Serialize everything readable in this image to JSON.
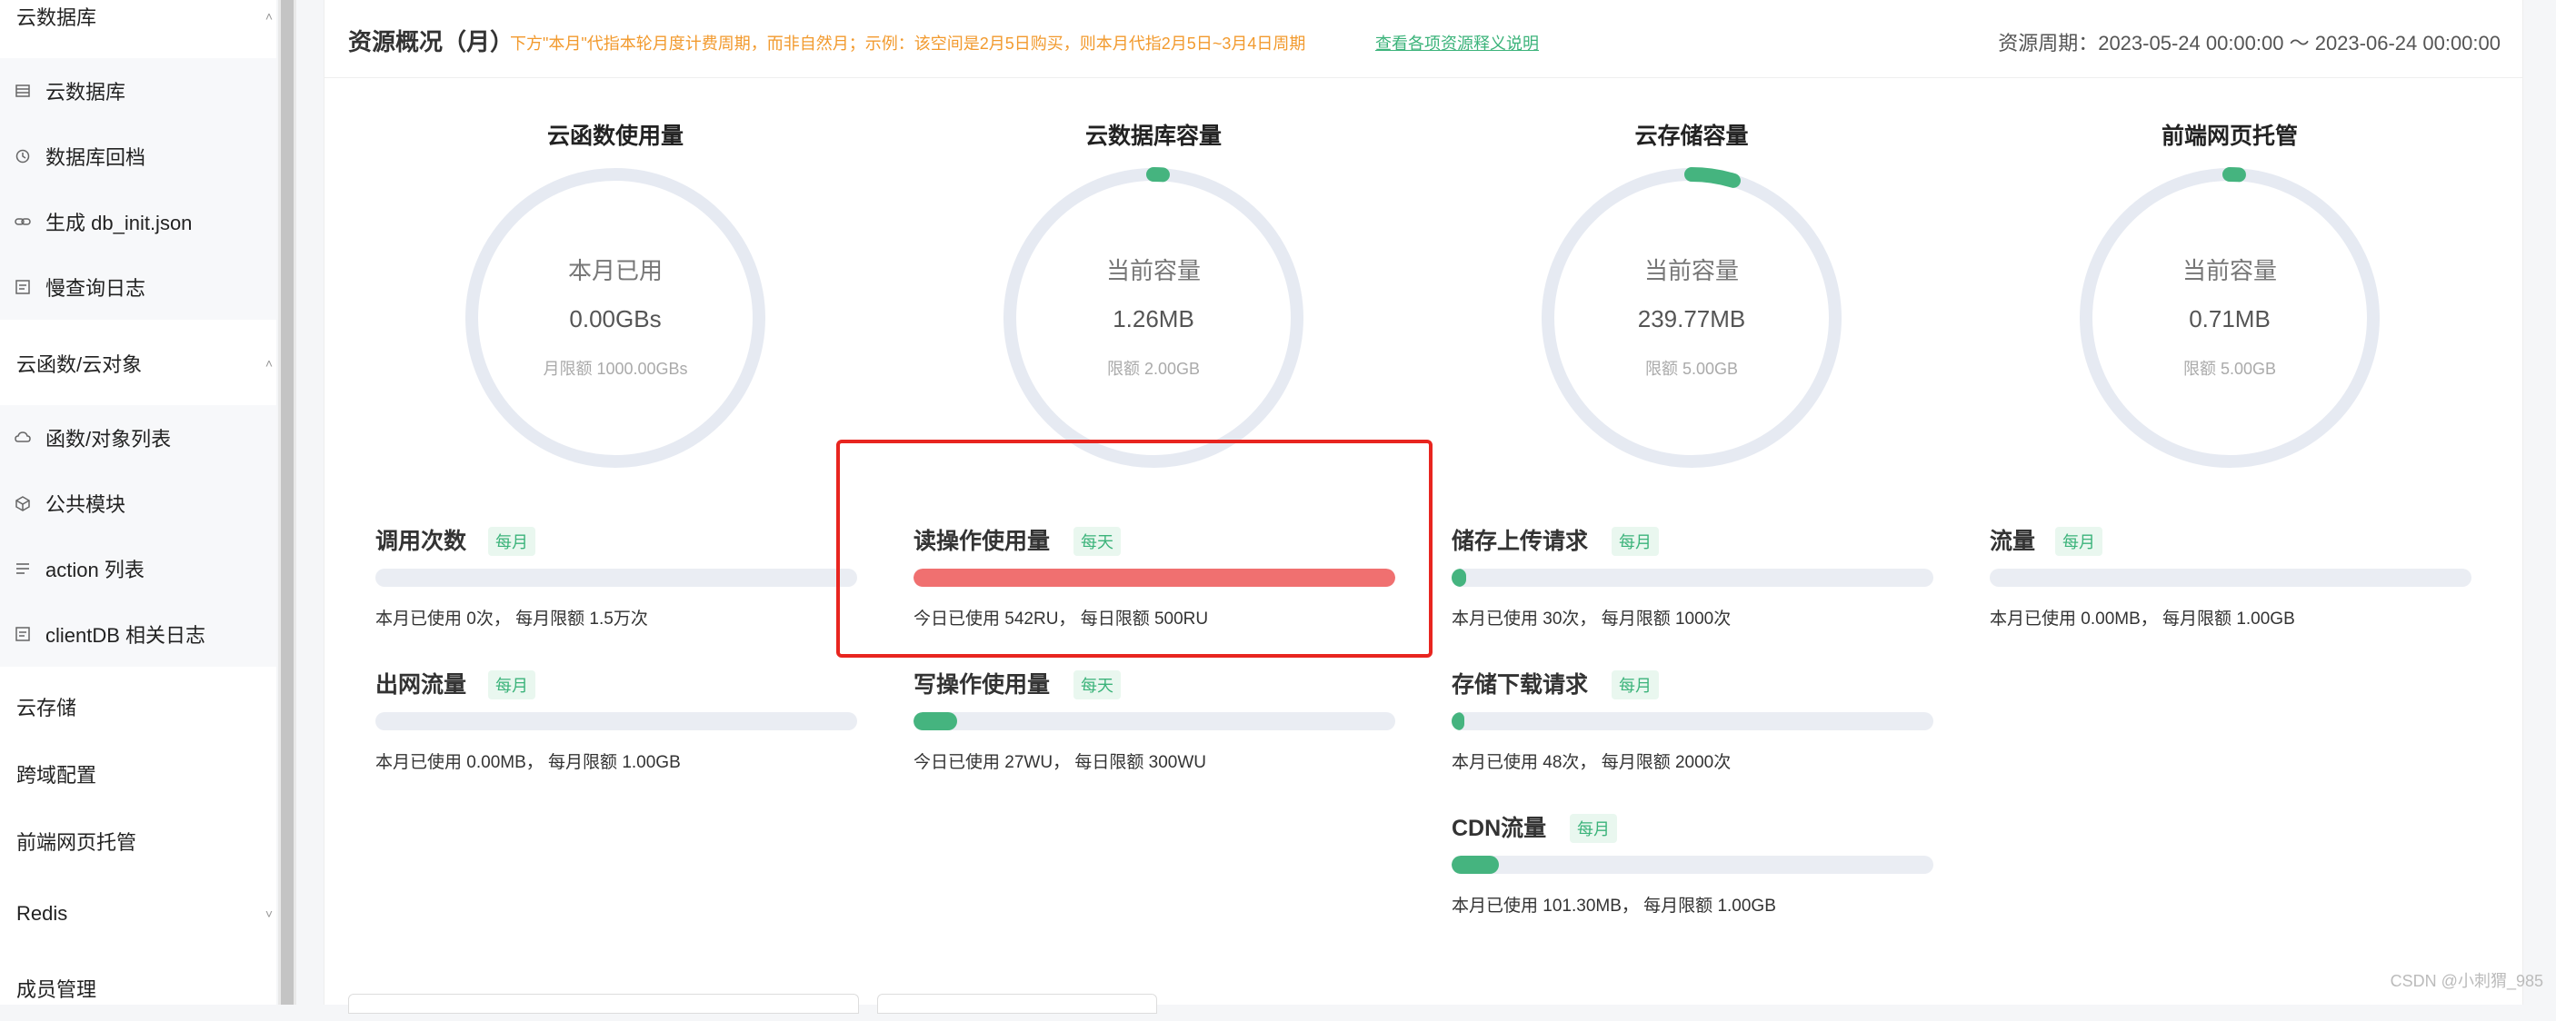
{
  "sidebar": {
    "top_group": "云数据库",
    "db_items": [
      {
        "label": "云数据库",
        "icon": "table-icon"
      },
      {
        "label": "数据库回档",
        "icon": "history-icon"
      },
      {
        "label": "生成 db_init.json",
        "icon": "link-icon"
      },
      {
        "label": "慢查询日志",
        "icon": "log-icon"
      }
    ],
    "func_group": "云函数/云对象",
    "func_items": [
      {
        "label": "函数/对象列表",
        "icon": "cloud-icon"
      },
      {
        "label": "公共模块",
        "icon": "cube-icon"
      },
      {
        "label": "action 列表",
        "icon": "list-icon"
      },
      {
        "label": "clientDB 相关日志",
        "icon": "log-icon"
      }
    ],
    "plain_items": [
      "云存储",
      "跨域配置",
      "前端网页托管"
    ],
    "redis": "Redis",
    "members": "成员管理"
  },
  "header": {
    "title": "资源概况（月）",
    "note": "下方\"本月\"代指本轮月度计费周期，而非自然月；示例：该空间是2月5日购买，则本月代指2月5日~3月4日周期",
    "link": "查看各项资源释义说明",
    "period": "资源周期：2023-05-24 00:00:00 ～ 2023-06-24 00:00:00"
  },
  "gauges": [
    {
      "title": "云函数使用量",
      "label": "本月已用",
      "value": "0.00GBs",
      "limit": "月限额 1000.00GBs",
      "fraction": 0.0
    },
    {
      "title": "云数据库容量",
      "label": "当前容量",
      "value": "1.26MB",
      "limit": "限额 2.00GB",
      "fraction": 0.0006
    },
    {
      "title": "云存储容量",
      "label": "当前容量",
      "value": "239.77MB",
      "limit": "限额 5.00GB",
      "fraction": 0.047
    },
    {
      "title": "前端网页托管",
      "label": "当前容量",
      "value": "0.71MB",
      "limit": "限额 5.00GB",
      "fraction": 0.0001
    }
  ],
  "metrics": {
    "calls": {
      "title": "调用次数",
      "badge": "每月",
      "desc": "本月已使用 0次， 每月限额 1.5万次",
      "fraction": 0.0
    },
    "egress": {
      "title": "出网流量",
      "badge": "每月",
      "desc": "本月已使用 0.00MB， 每月限额 1.00GB",
      "fraction": 0.0
    },
    "read": {
      "title": "读操作使用量",
      "badge": "每天",
      "desc": "今日已使用 542RU， 每日限额 500RU",
      "fraction": 1.0
    },
    "write": {
      "title": "写操作使用量",
      "badge": "每天",
      "desc": "今日已使用 27WU， 每日限额 300WU",
      "fraction": 0.09
    },
    "upload": {
      "title": "储存上传请求",
      "badge": "每月",
      "desc": "本月已使用 30次， 每月限额 1000次",
      "fraction": 0.03
    },
    "download": {
      "title": "存储下载请求",
      "badge": "每月",
      "desc": "本月已使用 48次， 每月限额 2000次",
      "fraction": 0.024
    },
    "cdn": {
      "title": "CDN流量",
      "badge": "每月",
      "desc": "本月已使用 101.30MB， 每月限额 1.00GB",
      "fraction": 0.099
    },
    "traffic": {
      "title": "流量",
      "badge": "每月",
      "desc": "本月已使用 0.00MB， 每月限额 1.00GB",
      "fraction": 0.0
    }
  },
  "colors": {
    "accent": "#45b47f",
    "danger": "#f07070",
    "track": "#e6eaf2",
    "highlight": "#e8251f"
  },
  "watermark": "CSDN @小刺猬_985"
}
